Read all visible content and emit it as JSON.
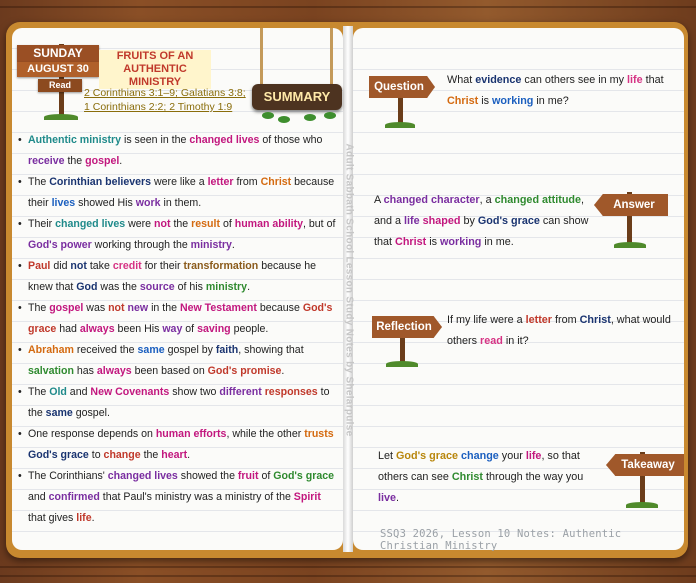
{
  "header": {
    "day": "SUNDAY",
    "date": "AUGUST 30",
    "read_label": "Read",
    "title_line1": "FRUITS OF AN AUTHENTIC",
    "title_line2": "MINISTRY",
    "refs_line1": "2 Corinthians 3:1–9; Galatians 3:8;",
    "refs_line2": "1 Corinthians 2:2; 2 Timothy 1:9",
    "summary_label": "SUMMARY"
  },
  "spine_text": "Adult Sabbath School Lesson Study Notes by Shelarpulse",
  "bullets": [
    [
      [
        "Authentic ministry",
        "teal"
      ],
      [
        " is seen in the ",
        ""
      ],
      [
        "changed lives",
        "mag"
      ],
      [
        " of those who ",
        ""
      ],
      [
        "receive",
        "purple"
      ],
      [
        " the ",
        ""
      ],
      [
        "gospel",
        "mag"
      ],
      [
        ".",
        ""
      ]
    ],
    [
      [
        "The ",
        ""
      ],
      [
        "Corinthian believers",
        "navy"
      ],
      [
        " were like a ",
        ""
      ],
      [
        "letter",
        "mag"
      ],
      [
        " from ",
        ""
      ],
      [
        "Christ",
        "orange"
      ],
      [
        " because their ",
        ""
      ],
      [
        "lives",
        "blue"
      ],
      [
        " showed His ",
        ""
      ],
      [
        "work",
        "purple"
      ],
      [
        " in them.",
        ""
      ]
    ],
    [
      [
        "Their ",
        ""
      ],
      [
        "changed lives",
        "teal"
      ],
      [
        " were ",
        ""
      ],
      [
        "not",
        "mag"
      ],
      [
        " the ",
        ""
      ],
      [
        "result",
        "orange"
      ],
      [
        " of ",
        ""
      ],
      [
        "human ability",
        "mag"
      ],
      [
        ", but of ",
        ""
      ],
      [
        "God's power",
        "purple"
      ],
      [
        " working through the ",
        ""
      ],
      [
        "ministry",
        "purple"
      ],
      [
        ".",
        ""
      ]
    ],
    [
      [
        "Paul",
        "red"
      ],
      [
        " did ",
        ""
      ],
      [
        "not",
        "navy"
      ],
      [
        " take ",
        ""
      ],
      [
        "credit",
        "pink"
      ],
      [
        " for their ",
        ""
      ],
      [
        "transformation",
        "brown"
      ],
      [
        " because he knew that ",
        ""
      ],
      [
        "God",
        "navy"
      ],
      [
        " was the ",
        ""
      ],
      [
        "source",
        "purple"
      ],
      [
        " of his ",
        ""
      ],
      [
        "ministry",
        "green"
      ],
      [
        ".",
        ""
      ]
    ],
    [
      [
        "The ",
        ""
      ],
      [
        "gospel",
        "mag"
      ],
      [
        " was ",
        ""
      ],
      [
        "not",
        "red"
      ],
      [
        " ",
        ""
      ],
      [
        "new",
        "purple"
      ],
      [
        " in the ",
        ""
      ],
      [
        "New Testament",
        "mag"
      ],
      [
        " because ",
        ""
      ],
      [
        "God's grace",
        "red"
      ],
      [
        " had ",
        ""
      ],
      [
        "always",
        "mag"
      ],
      [
        " been His ",
        ""
      ],
      [
        "way",
        "purple"
      ],
      [
        " of ",
        ""
      ],
      [
        "saving",
        "mag"
      ],
      [
        " people.",
        ""
      ]
    ],
    [
      [
        "Abraham",
        "orange"
      ],
      [
        " received the ",
        ""
      ],
      [
        "same",
        "blue"
      ],
      [
        " gospel by ",
        ""
      ],
      [
        "faith",
        "navy"
      ],
      [
        ", showing that ",
        ""
      ],
      [
        "salvation",
        "green"
      ],
      [
        " has ",
        ""
      ],
      [
        "always",
        "mag"
      ],
      [
        " been based on ",
        ""
      ],
      [
        "God's promise",
        "red"
      ],
      [
        ".",
        ""
      ]
    ],
    [
      [
        "The ",
        ""
      ],
      [
        "Old",
        "teal"
      ],
      [
        " and ",
        ""
      ],
      [
        "New Covenants",
        "mag"
      ],
      [
        " show two ",
        ""
      ],
      [
        "different",
        "purple"
      ],
      [
        " ",
        ""
      ],
      [
        "responses",
        "red"
      ],
      [
        " to the ",
        ""
      ],
      [
        "same",
        "navy"
      ],
      [
        " gospel.",
        ""
      ]
    ],
    [
      [
        "One response depends on ",
        ""
      ],
      [
        "human efforts",
        "mag"
      ],
      [
        ", while the other ",
        ""
      ],
      [
        "trusts",
        "orange"
      ],
      [
        " ",
        ""
      ],
      [
        "God's grace",
        "navy"
      ],
      [
        " to ",
        ""
      ],
      [
        "change",
        "red"
      ],
      [
        " the ",
        ""
      ],
      [
        "heart",
        "mag"
      ],
      [
        ".",
        ""
      ]
    ],
    [
      [
        "The Corinthians' ",
        ""
      ],
      [
        "changed lives",
        "purple"
      ],
      [
        " showed the ",
        ""
      ],
      [
        "fruit",
        "mag"
      ],
      [
        " of ",
        ""
      ],
      [
        "God's grace",
        "green"
      ],
      [
        " and ",
        ""
      ],
      [
        "confirmed",
        "purple"
      ],
      [
        " that Paul's ministry was a ministry of the ",
        ""
      ],
      [
        "Spirit",
        "mag"
      ],
      [
        " that gives ",
        ""
      ],
      [
        "life",
        "red"
      ],
      [
        ".",
        ""
      ]
    ]
  ],
  "question": {
    "label": "Question",
    "text": [
      [
        "What ",
        ""
      ],
      [
        "evidence",
        "navy"
      ],
      [
        " can others see in my ",
        ""
      ],
      [
        "life",
        "pink"
      ],
      [
        " that ",
        ""
      ],
      [
        "Christ",
        "orange"
      ],
      [
        " is ",
        ""
      ],
      [
        "working",
        "blue"
      ],
      [
        " in me?",
        ""
      ]
    ]
  },
  "answer": {
    "label": "Answer",
    "text": [
      [
        "A ",
        ""
      ],
      [
        "changed character",
        "purple"
      ],
      [
        ", a ",
        ""
      ],
      [
        "changed attitude",
        "green"
      ],
      [
        ", and a ",
        ""
      ],
      [
        "life",
        "purple"
      ],
      [
        " ",
        ""
      ],
      [
        "shaped",
        "mag"
      ],
      [
        " by ",
        ""
      ],
      [
        "God's grace",
        "navy"
      ],
      [
        " can show that ",
        ""
      ],
      [
        "Christ",
        "mag"
      ],
      [
        " is ",
        ""
      ],
      [
        "working",
        "purple"
      ],
      [
        " in me.",
        ""
      ]
    ]
  },
  "reflection": {
    "label": "Reflection",
    "text": [
      [
        "If my life were a ",
        ""
      ],
      [
        "letter",
        "red"
      ],
      [
        " from ",
        ""
      ],
      [
        "Christ",
        "navy"
      ],
      [
        ", what would others ",
        ""
      ],
      [
        "read",
        "pink"
      ],
      [
        " in it?",
        ""
      ]
    ]
  },
  "takeaway": {
    "label": "Takeaway",
    "text": [
      [
        "Let ",
        ""
      ],
      [
        "God's grace",
        "gold"
      ],
      [
        " ",
        ""
      ],
      [
        "change",
        "blue"
      ],
      [
        " your ",
        ""
      ],
      [
        "life",
        "mag"
      ],
      [
        ", so that others can see ",
        ""
      ],
      [
        "Christ",
        "green"
      ],
      [
        " through the way you ",
        ""
      ],
      [
        "live",
        "purple"
      ],
      [
        ".",
        ""
      ]
    ]
  },
  "footer": "SSQ3 2026, Lesson 10 Notes: Authentic Christian Ministry",
  "colors": {
    "teal": "#1f8a8a",
    "mag": "#c2177e",
    "purple": "#7a2ea0",
    "blue": "#1b5fbf",
    "navy": "#1a3470",
    "orange": "#d46a10",
    "red": "#c0392b",
    "green": "#2f8a2f",
    "brown": "#8a5a1a",
    "gold": "#b8860b",
    "pink": "#d63384"
  }
}
